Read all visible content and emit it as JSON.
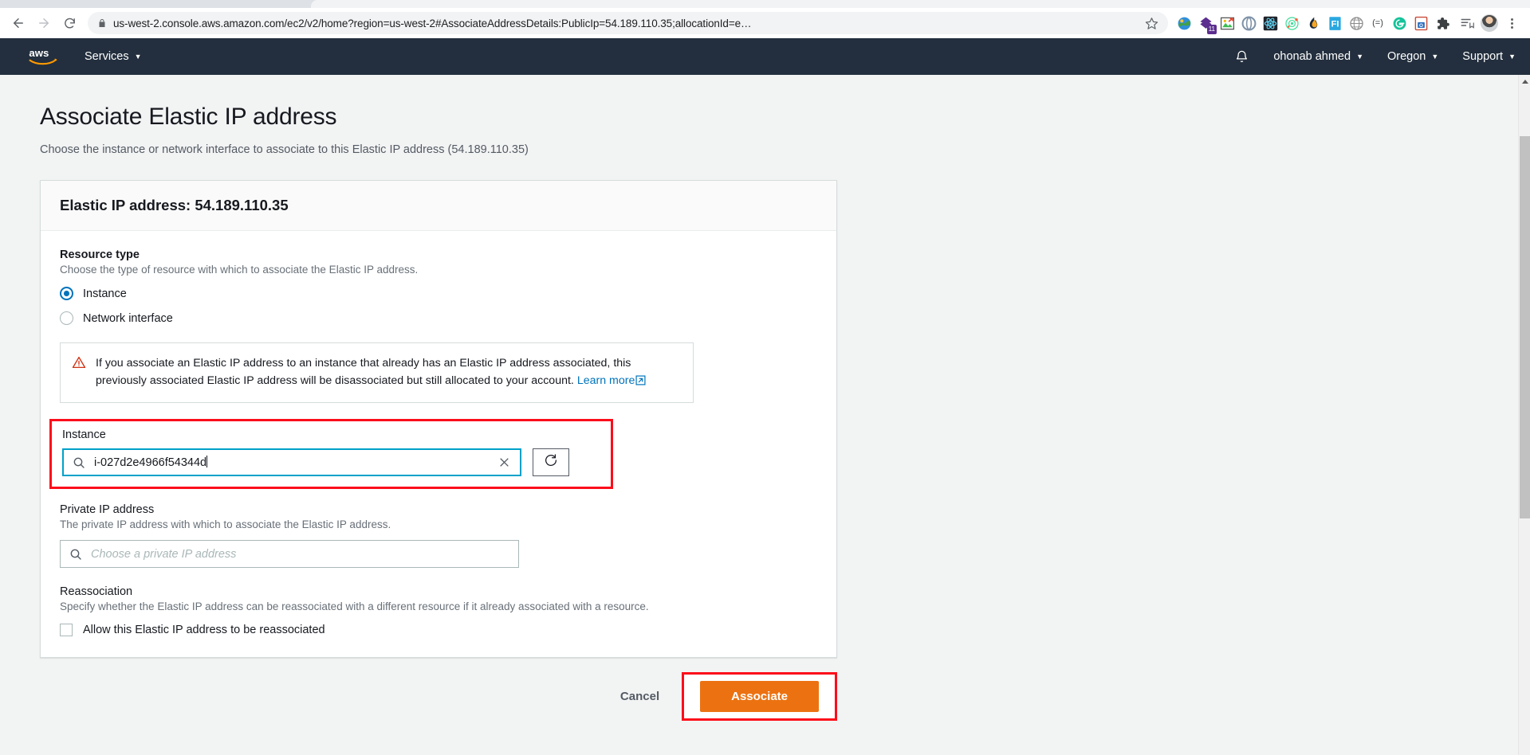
{
  "browser": {
    "back_icon": "back-arrow-icon",
    "forward_icon": "forward-arrow-icon",
    "reload_icon": "reload-icon",
    "lock_icon": "lock-icon",
    "url": "us-west-2.console.aws.amazon.com/ec2/v2/home?region=us-west-2#AssociateAddressDetails:PublicIp=54.189.110.35;allocationId=e…",
    "star_icon": "bookmark-star-icon",
    "extensions": [
      {
        "name": "colorpick-extension-icon",
        "glyph": "🌐",
        "badge": ""
      },
      {
        "name": "evernote-extension-icon",
        "glyph": "⬟",
        "badge": "11"
      },
      {
        "name": "screenshot-extension-icon",
        "glyph": "🖼",
        "badge": ""
      },
      {
        "name": "loom-extension-icon",
        "glyph": "◌",
        "badge": ""
      },
      {
        "name": "react-devtools-extension-icon",
        "glyph": "⚛",
        "badge": ""
      },
      {
        "name": "orbit-extension-icon",
        "glyph": "◎",
        "badge": ""
      },
      {
        "name": "flame-extension-icon",
        "glyph": "🔥",
        "badge": ""
      },
      {
        "name": "fi-extension-icon",
        "glyph": "FI",
        "badge": ""
      },
      {
        "name": "globe-extension-icon",
        "glyph": "⊕",
        "badge": ""
      },
      {
        "name": "equals-extension-icon",
        "glyph": "(=)",
        "badge": ""
      },
      {
        "name": "grammarly-extension-icon",
        "glyph": "G",
        "badge": ""
      },
      {
        "name": "onenote-clipper-extension-icon",
        "glyph": "O",
        "badge": ""
      },
      {
        "name": "extensions-puzzle-icon",
        "glyph": "🧩",
        "badge": ""
      }
    ],
    "reading_list_icon": "reading-list-icon",
    "profile_avatar": "profile-avatar",
    "menu_icon": "chrome-menu-kebab-icon"
  },
  "aws_nav": {
    "logo": "aws-logo",
    "services_label": "Services",
    "bell_icon": "notifications-bell-icon",
    "account_label": "ohonab ahmed",
    "region_label": "Oregon",
    "support_label": "Support",
    "caret": "▼"
  },
  "page": {
    "title": "Associate Elastic IP address",
    "subtitle": "Choose the instance or network interface to associate to this Elastic IP address (54.189.110.35)"
  },
  "card": {
    "header": "Elastic IP address: 54.189.110.35",
    "resource_type": {
      "label": "Resource type",
      "description": "Choose the type of resource with which to associate the Elastic IP address.",
      "options": [
        {
          "label": "Instance",
          "selected": true
        },
        {
          "label": "Network interface",
          "selected": false
        }
      ]
    },
    "alert": {
      "icon": "warning-triangle-icon",
      "text": "If you associate an Elastic IP address to an instance that already has an Elastic IP address associated, this previously associated Elastic IP address will be disassociated but still allocated to your account. ",
      "link_label": "Learn more",
      "link_icon": "external-link-icon"
    },
    "instance": {
      "label": "Instance",
      "search_icon": "search-icon",
      "value": "i-027d2e4966f54344d",
      "clear_icon": "clear-x-icon",
      "refresh_icon": "refresh-icon",
      "highlight_color": "#fc0d1b",
      "focus_border_color": "#00a1c9"
    },
    "private_ip": {
      "label": "Private IP address",
      "description": "The private IP address with which to associate the Elastic IP address.",
      "search_icon": "search-icon",
      "placeholder": "Choose a private IP address",
      "value": ""
    },
    "reassociation": {
      "label": "Reassociation",
      "description": "Specify whether the Elastic IP address can be reassociated with a different resource if it already associated with a resource.",
      "checkbox_label": "Allow this Elastic IP address to be reassociated",
      "checked": false
    }
  },
  "actions": {
    "cancel_label": "Cancel",
    "associate_label": "Associate",
    "associate_color": "#ec7211",
    "highlight_color": "#fc0d1b"
  },
  "scrollbar": {
    "arrow_up_icon": "scroll-arrow-up-icon",
    "thumb": "scroll-thumb"
  }
}
